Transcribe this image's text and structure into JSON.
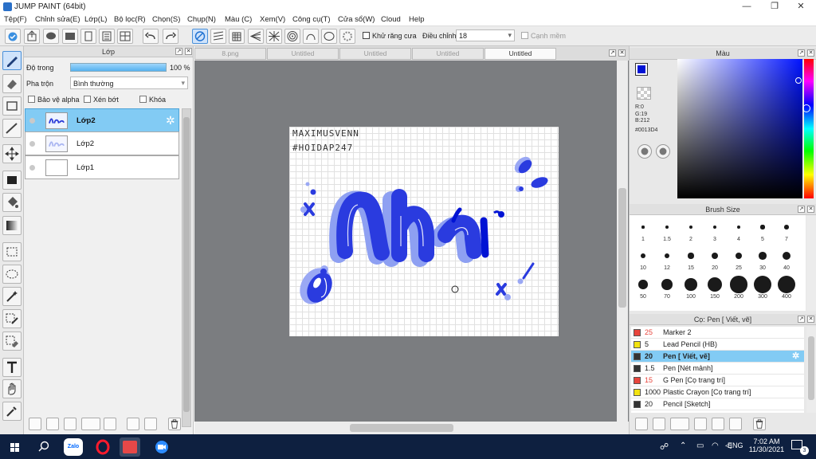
{
  "app": {
    "title": "JUMP PAINT (64bit)",
    "minimize": "—",
    "maximize": "❐",
    "close": "✕"
  },
  "menu": [
    "Tệp(F)",
    "Chỉnh sửa(E)",
    "Lớp(L)",
    "Bộ lọc(R)",
    "Chọn(S)",
    "Chụp(N)",
    "Màu (C)",
    "Xem(V)",
    "Công cụ(T)",
    "Cửa sổ(W)",
    "Cloud",
    "Help"
  ],
  "toolbar": {
    "antialias_label": "Khử răng cưa",
    "adjust_label": "Điều chỉnh",
    "adjust_value": "18",
    "sharp_label": "Cạnh mềm"
  },
  "layer_panel": {
    "title": "Lớp",
    "opacity_label": "Độ trong",
    "opacity_value": "100 %",
    "opacity": 1.0,
    "blend_label": "Pha trộn",
    "blend_value": "Bình thường",
    "protect_alpha": "Bảo vệ alpha",
    "clip": "Xén bớt",
    "lock": "Khóa",
    "layers": [
      {
        "name": "Lớp2",
        "selected": true
      },
      {
        "name": "Lớp2",
        "selected": false
      },
      {
        "name": "Lớp1",
        "selected": false
      }
    ]
  },
  "canvas": {
    "tabs": [
      {
        "label": "8.png",
        "active": false
      },
      {
        "label": "Untitled",
        "active": false
      },
      {
        "label": "Untitled",
        "active": false
      },
      {
        "label": "Untitled",
        "active": false
      },
      {
        "label": "Untitled",
        "active": true
      }
    ],
    "art_line1": "MAXIMUSVENN",
    "art_line2": "#HOIDAP247",
    "art_word": "Nhi",
    "color_dark": "#0013d4",
    "color_light": "#7a8cf0"
  },
  "color_panel": {
    "title": "Màu",
    "r": "R:0",
    "g": "G:19",
    "b": "B:212",
    "hex": "#0013D4",
    "current_color": "#0013D4"
  },
  "brush_size": {
    "title": "Brush Size",
    "sizes": [
      "1",
      "1.5",
      "2",
      "3",
      "4",
      "5",
      "7",
      "10",
      "12",
      "15",
      "20",
      "25",
      "30",
      "40",
      "50",
      "70",
      "100",
      "150",
      "200",
      "300",
      "400"
    ]
  },
  "brush_list": {
    "title": "Cọ: Pen [ Viết, vẽ]",
    "items": [
      {
        "color": "#e8453c",
        "size": "25",
        "name": "Marker 2",
        "selected": false
      },
      {
        "color": "#f2e20f",
        "size": "5",
        "name": "Lead Pencil (HB)",
        "selected": false
      },
      {
        "color": "#333333",
        "size": "20",
        "name": "Pen [ Viết, vẽ]",
        "selected": true
      },
      {
        "color": "#333333",
        "size": "1.5",
        "name": "Pen [Nét mảnh]",
        "selected": false
      },
      {
        "color": "#e8453c",
        "size": "15",
        "name": "G Pen [Cọ trang trí]",
        "selected": false
      },
      {
        "color": "#f2e20f",
        "size": "1000",
        "name": "Plastic Crayon [Cọ trang trí]",
        "selected": false
      },
      {
        "color": "#333333",
        "size": "20",
        "name": "Pencil [Sketch]",
        "selected": false
      }
    ]
  },
  "taskbar": {
    "time": "7:02 AM",
    "date": "11/30/2021",
    "lang": "ENG",
    "notif": "3",
    "zalo": "Zalo"
  }
}
